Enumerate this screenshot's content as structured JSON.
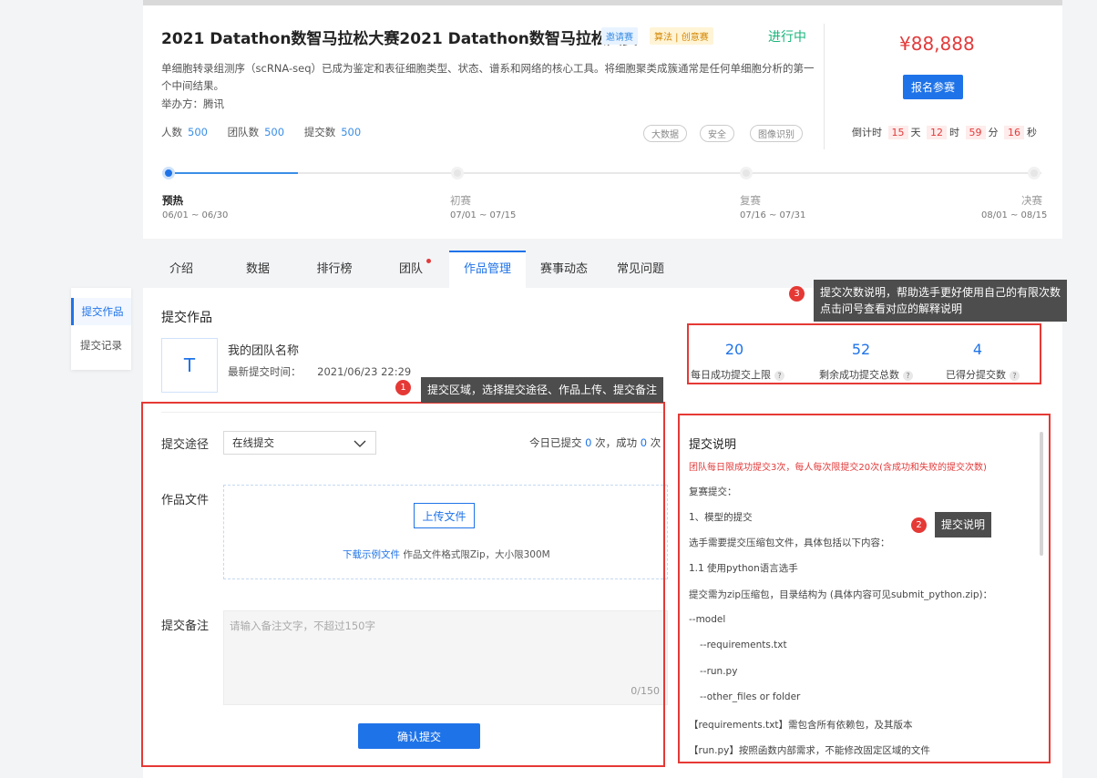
{
  "contest": {
    "title": "2021 Datathon数智马拉松大赛2021 Datathon数智马拉松大赛",
    "tags": [
      "邀请赛",
      "算法 | 创意赛"
    ],
    "status": "进行中",
    "description": "单细胞转录组测序（scRNA-seq）已成为鉴定和表征细胞类型、状态、谱系和网络的核心工具。将细胞聚类成簇通常是任何单细胞分析的第一个中间结果。",
    "host": "举办方：腾讯",
    "stats": [
      {
        "label": "人数",
        "value": "500"
      },
      {
        "label": "团队数",
        "value": "500"
      },
      {
        "label": "提交数",
        "value": "500"
      }
    ],
    "topic_tags": [
      "大数据",
      "安全",
      "图像识别"
    ],
    "prize": "¥88,888",
    "register_label": "报名参赛",
    "countdown": {
      "label": "倒计时",
      "days": "15",
      "days_unit": "天",
      "hours": "12",
      "hours_unit": "时",
      "minutes": "59",
      "minutes_unit": "分",
      "seconds": "16",
      "seconds_unit": "秒"
    },
    "timeline": [
      {
        "name": "预热",
        "date": "06/01 ~ 06/30"
      },
      {
        "name": "初赛",
        "date": "07/01 ~ 07/15"
      },
      {
        "name": "复赛",
        "date": "07/16 ~ 07/31"
      },
      {
        "name": "决赛",
        "date": "08/01 ~ 08/15"
      }
    ]
  },
  "tabs": [
    "介绍",
    "数据",
    "排行榜",
    "团队",
    "作品管理",
    "赛事动态",
    "常见问题"
  ],
  "sidenav": [
    "提交作品",
    "提交记录"
  ],
  "submit": {
    "heading": "提交作品",
    "avatar_letter": "T",
    "team_name": "我的团队名称",
    "last_submit_label": "最新提交时间：",
    "last_submit_time": "2021/06/23 22:29",
    "path_label": "提交途径",
    "path_value": "在线提交",
    "today_prefix": "今日已提交",
    "today_count": "0",
    "today_mid": "次，成功",
    "success_count": "0",
    "today_suffix": "次",
    "file_label": "作品文件",
    "upload_label": "上传文件",
    "sample_link": "下载示例文件",
    "file_hint": "作品文件格式限Zip，大小限300M",
    "remark_label": "提交备注",
    "remark_placeholder": "请输入备注文字，不超过150字",
    "remark_counter": "0/150",
    "confirm_label": "确认提交"
  },
  "limits": [
    {
      "value": "20",
      "label": "每日成功提交上限"
    },
    {
      "value": "52",
      "label": "剩余成功提交总数"
    },
    {
      "value": "4",
      "label": "已得分提交数"
    }
  ],
  "notes": {
    "title": "提交说明",
    "warning": "团队每日限成功提交3次，每人每次限提交20次(含成功和失败的提交次数)",
    "lines": [
      "复赛提交：",
      "1、模型的提交",
      "选手需要提交压缩包文件，具体包括以下内容：",
      "1.1 使用python语言选手",
      "提交需为zip压缩包，目录结构为 (具体内容可见submit_python.zip)：",
      "--model",
      "--requirements.txt",
      "--run.py",
      "--other_files or folder",
      "【requirements.txt】需包含所有依赖包，及其版本",
      "【run.py】按照函数内部需求，不能修改固定区域的文件"
    ]
  },
  "annotations": [
    {
      "num": "1",
      "text": "提交区域，选择提交途径、作品上传、提交备注"
    },
    {
      "num": "2",
      "text": "提交说明"
    },
    {
      "num": "3",
      "text": "提交次数说明，帮助选手更好使用自己的有限次数",
      "text2": "点击问号查看对应的解释说明"
    }
  ],
  "colors": {
    "primary": "#1f73e8",
    "danger": "#e23b3b",
    "success": "#19b47c",
    "annotation": "#e53935"
  }
}
